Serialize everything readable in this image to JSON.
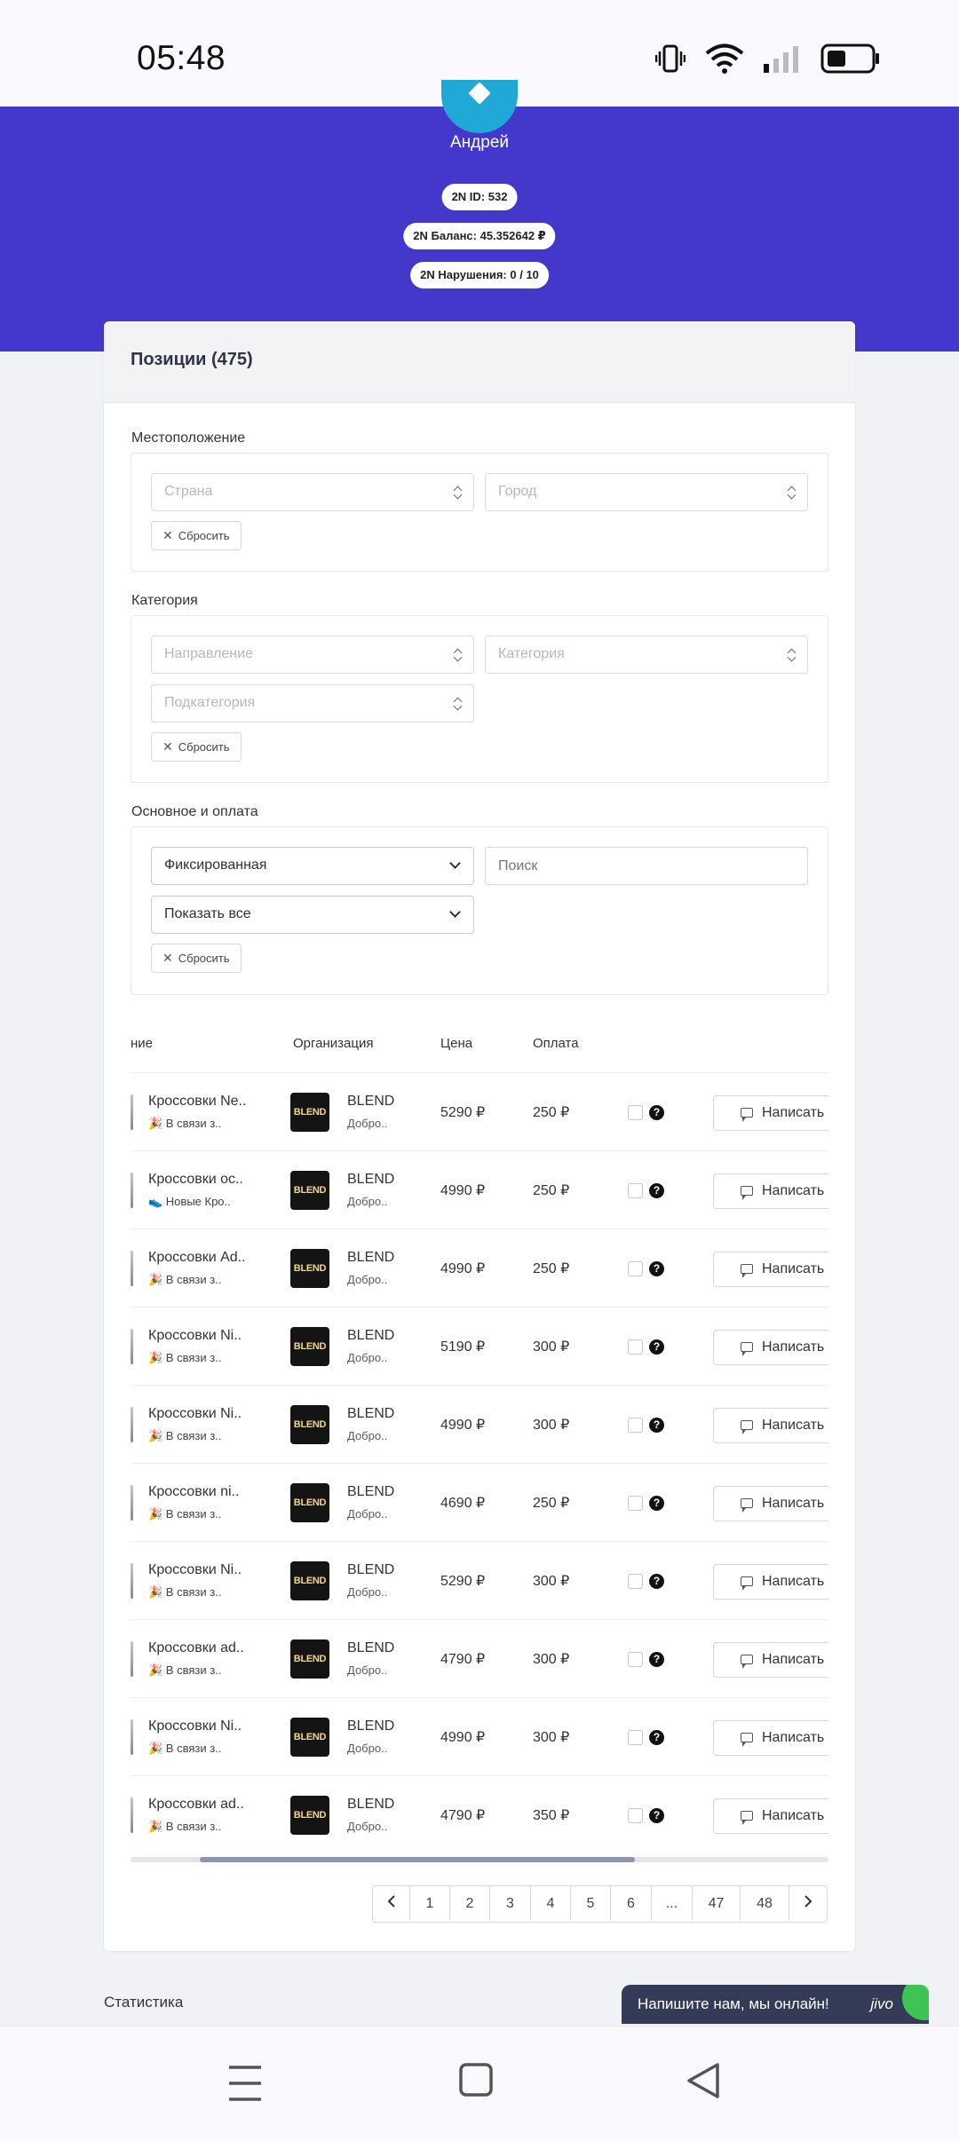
{
  "status_bar": {
    "time": "05:48"
  },
  "profile": {
    "name": "Андрей",
    "id_label": "2N ID: 532",
    "balance_label": "2N Баланс: 45.352642 ₽",
    "violations_label": "2N Нарушения: 0 / 10"
  },
  "positions": {
    "title": "Позиции (475)"
  },
  "filters": {
    "location": {
      "title": "Местоположение",
      "country_placeholder": "Страна",
      "city_placeholder": "Город",
      "reset": "Сбросить"
    },
    "category": {
      "title": "Категория",
      "direction_placeholder": "Направление",
      "category_placeholder": "Категория",
      "subcategory_placeholder": "Подкатегория",
      "reset": "Сбросить"
    },
    "main": {
      "title": "Основное и оплата",
      "payment_type": "Фиксированная",
      "search_placeholder": "Поиск",
      "show": "Показать все",
      "reset": "Сбросить"
    }
  },
  "table": {
    "headers": {
      "name": "ние",
      "org": "Организация",
      "price": "Цена",
      "payment": "Оплата"
    },
    "write_label": "Написать",
    "logo_text": "BLEND",
    "rows": [
      {
        "name": "Кроссовки Ne..",
        "sub": "🎉 В связи з..",
        "org": "BLEND",
        "org_sub": "Добро..",
        "price": "5290 ₽",
        "pay": "250 ₽"
      },
      {
        "name": "Кроссовки ос..",
        "sub": "👟 Новые Кро..",
        "org": "BLEND",
        "org_sub": "Добро..",
        "price": "4990 ₽",
        "pay": "250 ₽"
      },
      {
        "name": "Кроссовки Ad..",
        "sub": "🎉 В связи з..",
        "org": "BLEND",
        "org_sub": "Добро..",
        "price": "4990 ₽",
        "pay": "250 ₽"
      },
      {
        "name": "Кроссовки Ni..",
        "sub": "🎉 В связи з..",
        "org": "BLEND",
        "org_sub": "Добро..",
        "price": "5190 ₽",
        "pay": "300 ₽"
      },
      {
        "name": "Кроссовки Ni..",
        "sub": "🎉 В связи з..",
        "org": "BLEND",
        "org_sub": "Добро..",
        "price": "4990 ₽",
        "pay": "300 ₽"
      },
      {
        "name": "Кроссовки ni..",
        "sub": "🎉 В связи з..",
        "org": "BLEND",
        "org_sub": "Добро..",
        "price": "4690 ₽",
        "pay": "250 ₽"
      },
      {
        "name": "Кроссовки Ni..",
        "sub": "🎉 В связи з..",
        "org": "BLEND",
        "org_sub": "Добро..",
        "price": "5290 ₽",
        "pay": "300 ₽"
      },
      {
        "name": "Кроссовки ad..",
        "sub": "🎉 В связи з..",
        "org": "BLEND",
        "org_sub": "Добро..",
        "price": "4790 ₽",
        "pay": "300 ₽"
      },
      {
        "name": "Кроссовки Ni..",
        "sub": "🎉 В связи з..",
        "org": "BLEND",
        "org_sub": "Добро..",
        "price": "4990 ₽",
        "pay": "300 ₽"
      },
      {
        "name": "Кроссовки ad..",
        "sub": "🎉 В связи з..",
        "org": "BLEND",
        "org_sub": "Добро..",
        "price": "4790 ₽",
        "pay": "350 ₽"
      }
    ]
  },
  "pagination": [
    "1",
    "2",
    "3",
    "4",
    "5",
    "6",
    "...",
    "47",
    "48"
  ],
  "stats": {
    "title": "Статистика"
  },
  "chat": {
    "text": "Напишите нам, мы онлайн!",
    "brand": "jivo"
  },
  "colors": {
    "header_bg": "#4337cc",
    "chat_bg": "#343b57",
    "online": "#3ec452"
  }
}
